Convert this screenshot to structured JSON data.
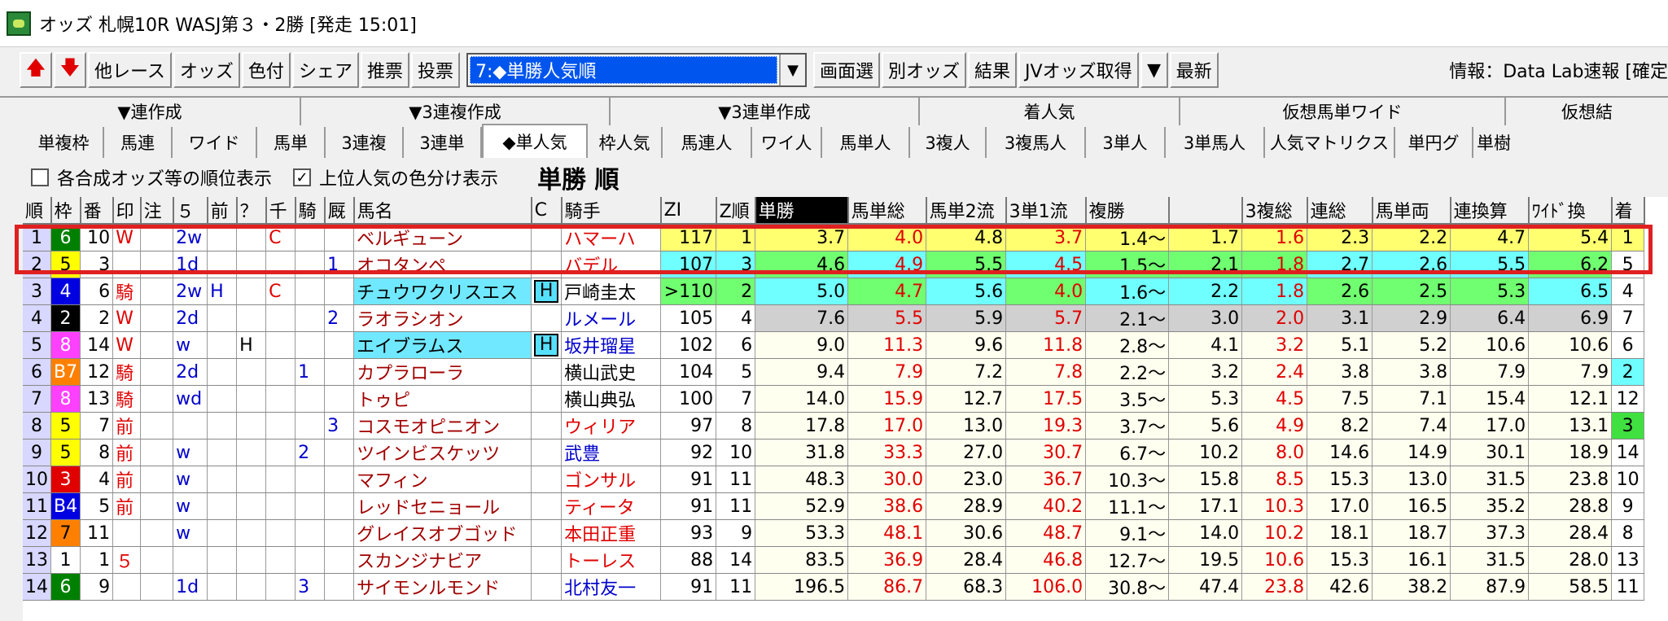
{
  "window": {
    "title": "オッズ 札幌10R WASJ第３・2勝 [発走 15:01]"
  },
  "toolbar": {
    "buttons": [
      "他レース",
      "オッズ",
      "色付",
      "シェア",
      "推票",
      "投票"
    ],
    "combo_value": "7:◆単勝人気順",
    "buttons2": [
      "画面選",
      "別オッズ",
      "結果",
      "JVオッズ取得",
      "▼",
      "最新"
    ],
    "info": "情報：Data Lab速報 [確定"
  },
  "tabs": {
    "groups": [
      "▼連作成",
      "▼3連複作成",
      "▼3連単作成",
      "着人気",
      "仮想馬単ワイド",
      "仮想結"
    ],
    "items": [
      "単複枠",
      "馬連",
      "ワイド",
      "馬単",
      "3連複",
      "3連単",
      "◆単人気",
      "枠人気",
      "馬連人",
      "ワイ人",
      "馬単人",
      "3複人",
      "3複馬人",
      "3単人",
      "3単馬人",
      "人気マトリクス",
      "単円グ",
      "単樹"
    ]
  },
  "options": {
    "opt1_label": "各合成オッズ等の順位表示",
    "opt1_checked": false,
    "opt2_label": "上位人気の色分け表示",
    "opt2_checked": true,
    "view_title": "単勝 順"
  },
  "columns": [
    "順",
    "枠",
    "番",
    "印",
    "注",
    "５",
    "前",
    "？",
    "千",
    "騎",
    "厩",
    "馬名",
    "C",
    "騎手",
    "ZI",
    "Z順",
    "単勝",
    "馬単総",
    "馬単2流",
    "3単1流",
    "複勝",
    "",
    "3複総",
    "連総",
    "馬単両",
    "連換算",
    "ﾜｲﾄﾞ換",
    "着"
  ],
  "rows": [
    {
      "rank": "1",
      "waku": "6",
      "ban": "10",
      "mark": "W",
      "chu": "",
      "five": "2w",
      "mae": "",
      "q": "",
      "sen": "C",
      "ki": "",
      "kyu": "",
      "name": "ベルギューン",
      "c": "",
      "jockey": "ハマーハ",
      "zi": "117",
      "zr": "1",
      "tan": "3.7",
      "ut": "4.0",
      "u2": "4.8",
      "s1": "3.7",
      "fuku1": "1.4～",
      "fuku2": "1.7",
      "f3": "1.6",
      "ren": "2.3",
      "uw": "2.2",
      "rk": "4.7",
      "wk": "5.4",
      "chaku": "1"
    },
    {
      "rank": "2",
      "waku": "5",
      "ban": "3",
      "mark": "",
      "chu": "",
      "five": "1d",
      "mae": "",
      "q": "",
      "sen": "",
      "ki": "",
      "kyu": "1",
      "name": "オコタンペ",
      "c": "",
      "jockey": "バデル",
      "zi": "107",
      "zr": "3",
      "tan": "4.6",
      "ut": "4.9",
      "u2": "5.5",
      "s1": "4.5",
      "fuku1": "1.5～",
      "fuku2": "2.1",
      "f3": "1.8",
      "ren": "2.7",
      "uw": "2.6",
      "rk": "5.5",
      "wk": "6.2",
      "chaku": "5"
    },
    {
      "rank": "3",
      "waku": "4",
      "ban": "6",
      "mark": "騎",
      "chu": "",
      "five": "2w",
      "mae": "H",
      "q": "",
      "sen": "C",
      "ki": "",
      "kyu": "",
      "name": "チュウワクリスエス",
      "c": "H",
      "jockey": "戸崎圭太",
      "zi": ">110",
      "zr": "2",
      "tan": "5.0",
      "ut": "4.7",
      "u2": "5.6",
      "s1": "4.0",
      "fuku1": "1.6～",
      "fuku2": "2.2",
      "f3": "1.8",
      "ren": "2.6",
      "uw": "2.5",
      "rk": "5.3",
      "wk": "6.5",
      "chaku": "4"
    },
    {
      "rank": "4",
      "waku": "2",
      "ban": "2",
      "mark": "W",
      "chu": "",
      "five": "2d",
      "mae": "",
      "q": "",
      "sen": "",
      "ki": "",
      "kyu": "2",
      "name": "ラオラシオン",
      "c": "",
      "jockey": "ルメール",
      "zi": "105",
      "zr": "4",
      "tan": "7.6",
      "ut": "5.5",
      "u2": "5.9",
      "s1": "5.7",
      "fuku1": "2.1～",
      "fuku2": "3.0",
      "f3": "2.0",
      "ren": "3.1",
      "uw": "2.9",
      "rk": "6.4",
      "wk": "6.9",
      "chaku": "7"
    },
    {
      "rank": "5",
      "waku": "8",
      "ban": "14",
      "mark": "W",
      "chu": "",
      "five": "w",
      "mae": "",
      "q": "H",
      "sen": "",
      "ki": "",
      "kyu": "",
      "name": "エイブラムス",
      "c": "H",
      "jockey": "坂井瑠星",
      "zi": "102",
      "zr": "6",
      "tan": "9.0",
      "ut": "11.3",
      "u2": "9.6",
      "s1": "11.8",
      "fuku1": "2.8～",
      "fuku2": "4.1",
      "f3": "3.2",
      "ren": "5.1",
      "uw": "5.2",
      "rk": "10.6",
      "wk": "10.6",
      "chaku": "6"
    },
    {
      "rank": "6",
      "waku": "B7",
      "ban": "12",
      "mark": "騎",
      "chu": "",
      "five": "2d",
      "mae": "",
      "q": "",
      "sen": "",
      "ki": "1",
      "kyu": "",
      "name": "カプラローラ",
      "c": "",
      "jockey": "横山武史",
      "zi": "104",
      "zr": "5",
      "tan": "9.4",
      "ut": "7.9",
      "u2": "7.2",
      "s1": "7.8",
      "fuku1": "2.2～",
      "fuku2": "3.2",
      "f3": "2.4",
      "ren": "3.8",
      "uw": "3.8",
      "rk": "7.9",
      "wk": "7.9",
      "chaku": "2"
    },
    {
      "rank": "7",
      "waku": "8",
      "ban": "13",
      "mark": "騎",
      "chu": "",
      "five": "wd",
      "mae": "",
      "q": "",
      "sen": "",
      "ki": "",
      "kyu": "",
      "name": "トゥピ",
      "c": "",
      "jockey": "横山典弘",
      "zi": "100",
      "zr": "7",
      "tan": "14.0",
      "ut": "15.9",
      "u2": "12.7",
      "s1": "17.5",
      "fuku1": "3.5～",
      "fuku2": "5.3",
      "f3": "4.5",
      "ren": "7.5",
      "uw": "7.1",
      "rk": "15.4",
      "wk": "12.1",
      "chaku": "12"
    },
    {
      "rank": "8",
      "waku": "5",
      "ban": "7",
      "mark": "前",
      "chu": "",
      "five": "",
      "mae": "",
      "q": "",
      "sen": "",
      "ki": "",
      "kyu": "3",
      "name": "コスモオピニオン",
      "c": "",
      "jockey": "ウィリア",
      "zi": "97",
      "zr": "8",
      "tan": "17.8",
      "ut": "17.0",
      "u2": "13.0",
      "s1": "19.3",
      "fuku1": "3.7～",
      "fuku2": "5.6",
      "f3": "4.9",
      "ren": "8.2",
      "uw": "7.4",
      "rk": "17.0",
      "wk": "13.1",
      "chaku": "3"
    },
    {
      "rank": "9",
      "waku": "5",
      "ban": "8",
      "mark": "前",
      "chu": "",
      "five": "w",
      "mae": "",
      "q": "",
      "sen": "",
      "ki": "2",
      "kyu": "",
      "name": "ツインビスケッツ",
      "c": "",
      "jockey": "武豊",
      "zi": "92",
      "zr": "10",
      "tan": "31.8",
      "ut": "33.3",
      "u2": "27.0",
      "s1": "30.7",
      "fuku1": "6.7～",
      "fuku2": "10.2",
      "f3": "8.0",
      "ren": "14.6",
      "uw": "14.9",
      "rk": "30.1",
      "wk": "18.9",
      "chaku": "14"
    },
    {
      "rank": "10",
      "waku": "3",
      "ban": "4",
      "mark": "前",
      "chu": "",
      "five": "w",
      "mae": "",
      "q": "",
      "sen": "",
      "ki": "",
      "kyu": "",
      "name": "マフィン",
      "c": "",
      "jockey": "ゴンサル",
      "zi": "91",
      "zr": "11",
      "tan": "48.3",
      "ut": "30.0",
      "u2": "23.0",
      "s1": "36.7",
      "fuku1": "10.3～",
      "fuku2": "15.8",
      "f3": "8.5",
      "ren": "15.3",
      "uw": "13.0",
      "rk": "31.5",
      "wk": "23.8",
      "chaku": "10"
    },
    {
      "rank": "11",
      "waku": "B4",
      "ban": "5",
      "mark": "前",
      "chu": "",
      "five": "w",
      "mae": "",
      "q": "",
      "sen": "",
      "ki": "",
      "kyu": "",
      "name": "レッドセニョール",
      "c": "",
      "jockey": "ティータ",
      "zi": "91",
      "zr": "11",
      "tan": "52.9",
      "ut": "38.6",
      "u2": "28.9",
      "s1": "40.2",
      "fuku1": "11.1～",
      "fuku2": "17.1",
      "f3": "10.3",
      "ren": "17.0",
      "uw": "16.5",
      "rk": "35.2",
      "wk": "28.8",
      "chaku": "9"
    },
    {
      "rank": "12",
      "waku": "7",
      "ban": "11",
      "mark": "",
      "chu": "",
      "five": "w",
      "mae": "",
      "q": "",
      "sen": "",
      "ki": "",
      "kyu": "",
      "name": "グレイスオブゴッド",
      "c": "",
      "jockey": "本田正重",
      "zi": "93",
      "zr": "9",
      "tan": "53.3",
      "ut": "48.1",
      "u2": "30.6",
      "s1": "48.7",
      "fuku1": "9.1～",
      "fuku2": "14.0",
      "f3": "10.2",
      "ren": "18.1",
      "uw": "18.7",
      "rk": "37.3",
      "wk": "28.4",
      "chaku": "8"
    },
    {
      "rank": "13",
      "waku": "1",
      "ban": "1",
      "mark": "５",
      "chu": "",
      "five": "",
      "mae": "",
      "q": "",
      "sen": "",
      "ki": "",
      "kyu": "",
      "name": "スカンジナビア",
      "c": "",
      "jockey": "トーレス",
      "zi": "88",
      "zr": "14",
      "tan": "83.5",
      "ut": "36.9",
      "u2": "28.4",
      "s1": "46.8",
      "fuku1": "12.7～",
      "fuku2": "19.5",
      "f3": "10.6",
      "ren": "15.3",
      "uw": "16.1",
      "rk": "31.5",
      "wk": "28.0",
      "chaku": "13"
    },
    {
      "rank": "14",
      "waku": "6",
      "ban": "9",
      "mark": "",
      "chu": "",
      "five": "1d",
      "mae": "",
      "q": "",
      "sen": "",
      "ki": "3",
      "kyu": "",
      "name": "サイモンルモンド",
      "c": "",
      "jockey": "北村友一",
      "zi": "91",
      "zr": "11",
      "tan": "196.5",
      "ut": "86.7",
      "u2": "68.3",
      "s1": "106.0",
      "fuku1": "30.8～",
      "fuku2": "47.4",
      "f3": "23.8",
      "ren": "42.6",
      "uw": "38.2",
      "rk": "87.9",
      "wk": "58.5",
      "chaku": "11"
    }
  ],
  "colors": {
    "waku": {
      "1": "#ffffff",
      "2": "#000000",
      "3": "#e00000",
      "4": "#0000e0",
      "5": "#ffff00",
      "6": "#008000",
      "7": "#ff8000",
      "8": "#ff40ff",
      "B4": "#0000e0",
      "B7": "#ff8000"
    },
    "pop_rank": {
      "1": "#ffff70",
      "2": "#70ff70",
      "3": "#70ffff",
      "4": "#d0d0d0",
      "5": "#fffff0"
    },
    "highlight_border": "#e02020"
  }
}
